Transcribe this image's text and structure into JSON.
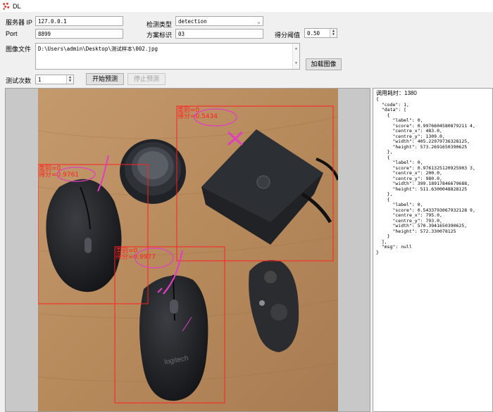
{
  "window": {
    "title": "DL"
  },
  "form": {
    "server_ip_label": "服务器 IP",
    "server_ip_value": "127.0.0.1",
    "port_label": "Port",
    "port_value": "8899",
    "detect_type_label": "检测类型",
    "detect_type_value": "detection",
    "scheme_label": "方案标识",
    "scheme_value": "03",
    "score_threshold_label": "得分阈值",
    "score_threshold_value": "0.50",
    "image_file_label": "图像文件",
    "image_file_value": "D:\\Users\\admin\\Desktop\\测试样本\\002.jpg",
    "load_image_button": "加载图像",
    "test_count_label": "测试次数",
    "test_count_value": "1",
    "start_button": "开始预测",
    "stop_button": "停止预测"
  },
  "detections": [
    {
      "class_label": "类别=0",
      "score_label": "得分=0.5434"
    },
    {
      "class_label": "类别=0",
      "score_label": "得分=0.9761"
    },
    {
      "class_label": "类别=0",
      "score_label": "得分=0.9977"
    }
  ],
  "result": {
    "time_label": "调用耗时：1380",
    "json_text": "{\n  \"code\": 1,\n  \"data\": [\n    {\n      \"label\": 0,\n      \"score\": 0.9976604580879211 4,\n      \"centre_x\": 483.0,\n      \"centre_y\": 1309.0,\n      \"width\": 405.22979736328125,\n      \"height\": 573.2691650390625\n    },\n    {\n      \"label\": 0,\n      \"score\": 0.9761325120925903 3,\n      \"centre_x\": 200.0,\n      \"centre_y\": 980.0,\n      \"width\": 399.18917846679688,\n      \"height\": 511.6300048828125\n    },\n    {\n      \"label\": 0,\n      \"score\": 0.5433793067932128 9,\n      \"centre_x\": 795.0,\n      \"centre_y\": 793.0,\n      \"width\": 570.3941650390625,\n      \"height\": 572.330078125\n    }\n  ],\n  \"msg\": null\n}"
  },
  "colors": {
    "box": "#ff2020",
    "annotation": "#e040c0",
    "selection_bg": "#ffffff"
  }
}
